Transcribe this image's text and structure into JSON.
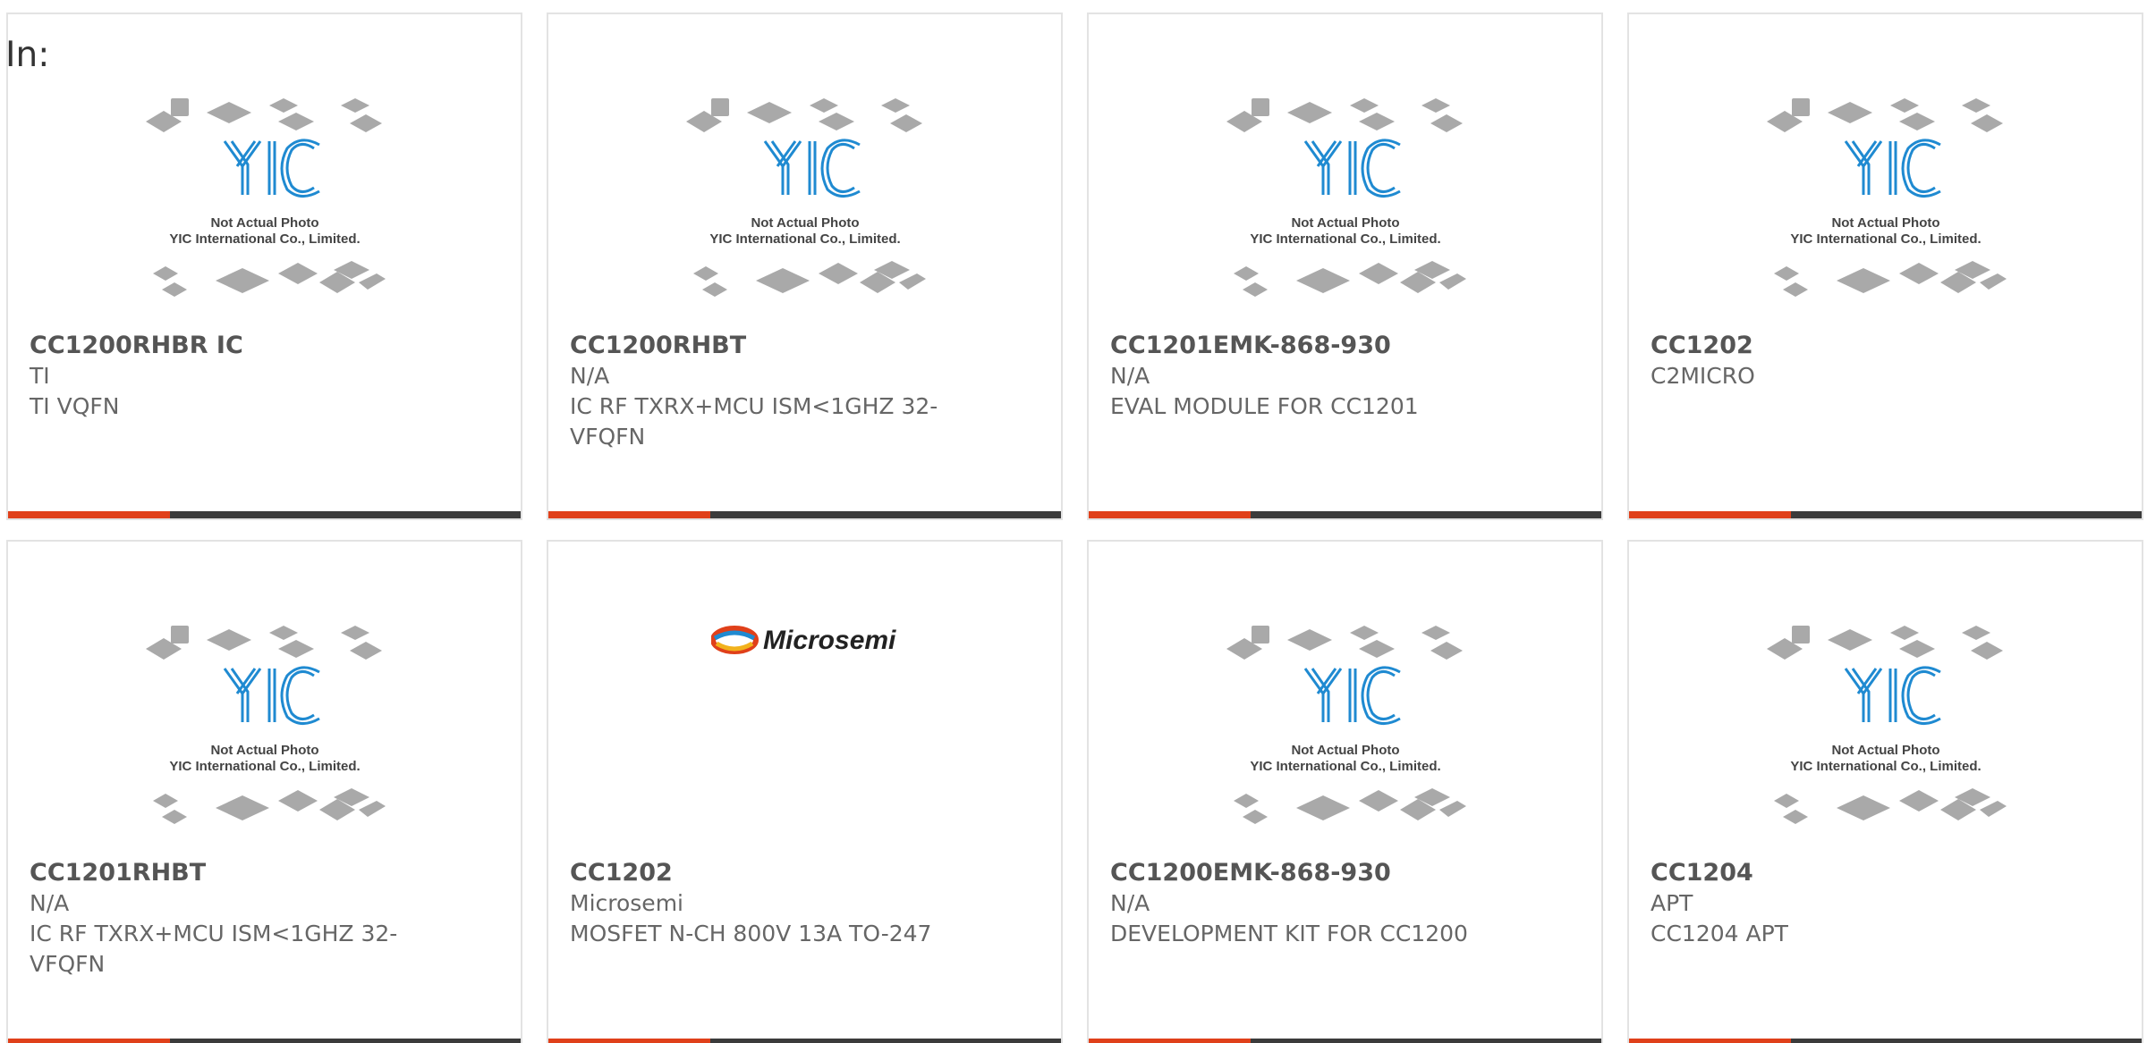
{
  "filter": {
    "label": "In:"
  },
  "products": [
    {
      "part": "CC1200RHBR IC",
      "manufacturer": "TI",
      "description": "TI VQFN",
      "image": "yic-placeholder",
      "image_caption": [
        "Not Actual Photo",
        "YIC International Co., Limited."
      ]
    },
    {
      "part": "CC1200RHBT",
      "manufacturer": "N/A",
      "description": "IC RF TXRX+MCU ISM<1GHZ 32-VFQFN",
      "image": "yic-placeholder",
      "image_caption": [
        "Not Actual Photo",
        "YIC International Co., Limited."
      ]
    },
    {
      "part": "CC1201EMK-868-930",
      "manufacturer": "N/A",
      "description": "EVAL MODULE FOR CC1201",
      "image": "yic-placeholder",
      "image_caption": [
        "Not Actual Photo",
        "YIC International Co., Limited."
      ]
    },
    {
      "part": "CC1202",
      "manufacturer": "C2MICRO",
      "description": "",
      "image": "yic-placeholder",
      "image_caption": [
        "Not Actual Photo",
        "YIC International Co., Limited."
      ]
    },
    {
      "part": "CC1201RHBT",
      "manufacturer": "N/A",
      "description": "IC RF TXRX+MCU ISM<1GHZ 32-VFQFN",
      "image": "yic-placeholder",
      "image_caption": [
        "Not Actual Photo",
        "YIC International Co., Limited."
      ]
    },
    {
      "part": "CC1202",
      "manufacturer": "Microsemi",
      "description": "MOSFET N-CH 800V 13A TO-247",
      "image": "microsemi-logo",
      "logo_text": "Microsemi"
    },
    {
      "part": "CC1200EMK-868-930",
      "manufacturer": "N/A",
      "description": "DEVELOPMENT KIT FOR CC1200",
      "image": "yic-placeholder",
      "image_caption": [
        "Not Actual Photo",
        "YIC International Co., Limited."
      ]
    },
    {
      "part": "CC1204",
      "manufacturer": "APT",
      "description": "CC1204 APT",
      "image": "yic-placeholder",
      "image_caption": [
        "Not Actual Photo",
        "YIC International Co., Limited."
      ]
    }
  ],
  "colors": {
    "accent": "#e0401a",
    "bar": "#3b3b3b",
    "yic_blue": "#1f8ad1",
    "chip_gray": "#a9a9a9"
  }
}
